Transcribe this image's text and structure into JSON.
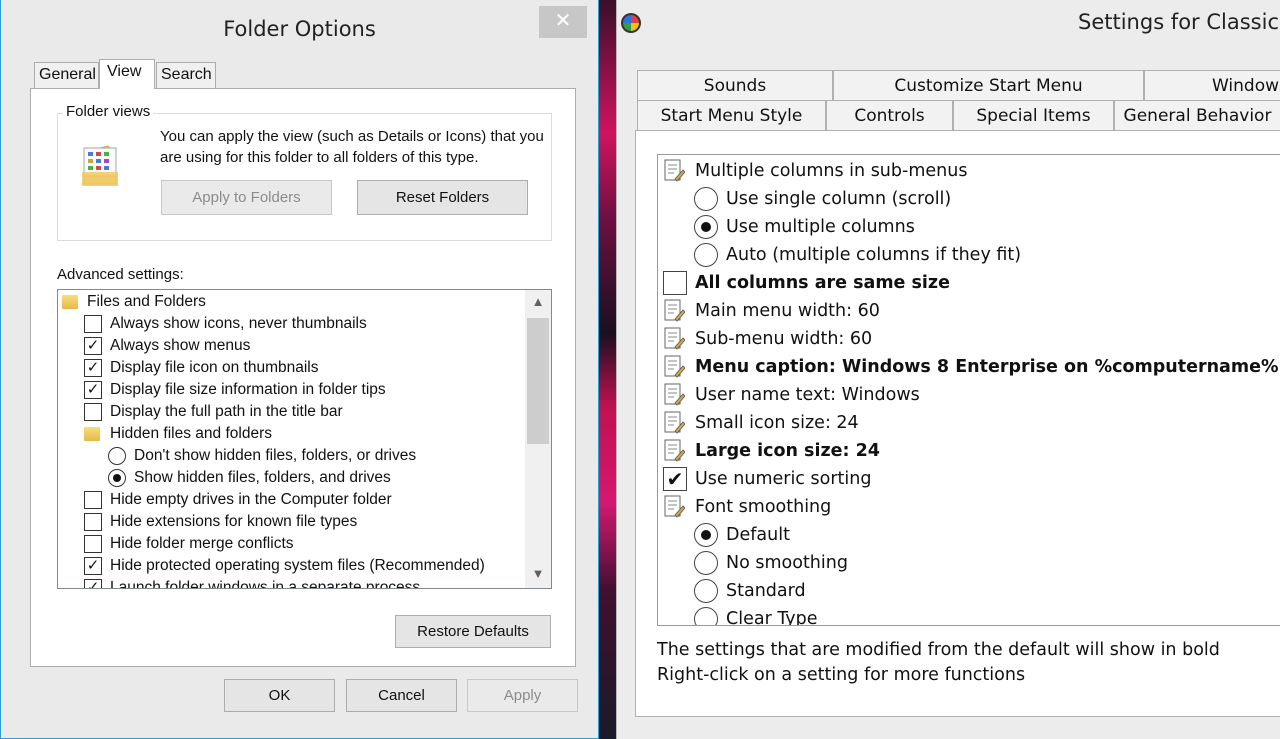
{
  "folder_options": {
    "title": "Folder Options",
    "close_glyph": "✕",
    "tabs": [
      "General",
      "View",
      "Search"
    ],
    "folder_views": {
      "label": "Folder views",
      "description": "You can apply the view (such as Details or Icons) that you are using for this folder to all folders of this type.",
      "apply_button": "Apply to Folders",
      "reset_button": "Reset Folders"
    },
    "advanced_label": "Advanced settings:",
    "tree": [
      {
        "type": "folder",
        "label": "Files and Folders"
      },
      {
        "type": "checkbox",
        "checked": false,
        "label": "Always show icons, never thumbnails"
      },
      {
        "type": "checkbox",
        "checked": true,
        "label": "Always show menus"
      },
      {
        "type": "checkbox",
        "checked": true,
        "label": "Display file icon on thumbnails"
      },
      {
        "type": "checkbox",
        "checked": true,
        "label": "Display file size information in folder tips"
      },
      {
        "type": "checkbox",
        "checked": false,
        "label": "Display the full path in the title bar"
      },
      {
        "type": "folder",
        "label": "Hidden files and folders"
      },
      {
        "type": "radio",
        "checked": false,
        "label": "Don't show hidden files, folders, or drives"
      },
      {
        "type": "radio",
        "checked": true,
        "label": "Show hidden files, folders, and drives"
      },
      {
        "type": "checkbox",
        "checked": false,
        "label": "Hide empty drives in the Computer folder"
      },
      {
        "type": "checkbox",
        "checked": false,
        "label": "Hide extensions for known file types"
      },
      {
        "type": "checkbox",
        "checked": false,
        "label": "Hide folder merge conflicts"
      },
      {
        "type": "checkbox",
        "checked": true,
        "label": "Hide protected operating system files (Recommended)"
      },
      {
        "type": "checkbox",
        "checked": true,
        "label": "Launch folder windows in a separate process"
      }
    ],
    "restore_button": "Restore Defaults",
    "ok_button": "OK",
    "cancel_button": "Cancel",
    "apply_button": "Apply"
  },
  "classic_shell": {
    "title": "Settings for Classic S",
    "tabs_row1": [
      "Sounds",
      "Customize Start Menu",
      "Windows"
    ],
    "tabs_row2": [
      "Start Menu Style",
      "Controls",
      "Special Items",
      "General Behavior"
    ],
    "settings": [
      {
        "type": "setting",
        "bold": false,
        "label": "Multiple columns in sub-menus"
      },
      {
        "type": "radio",
        "checked": false,
        "bold": false,
        "label": "Use single column (scroll)"
      },
      {
        "type": "radio",
        "checked": true,
        "bold": false,
        "label": "Use multiple columns"
      },
      {
        "type": "radio",
        "checked": false,
        "bold": false,
        "label": "Auto (multiple columns if they fit)"
      },
      {
        "type": "checkbox",
        "checked": false,
        "bold": true,
        "label": "All columns are same size"
      },
      {
        "type": "setting",
        "bold": false,
        "label": "Main menu width: 60"
      },
      {
        "type": "setting",
        "bold": false,
        "label": "Sub-menu width: 60"
      },
      {
        "type": "setting",
        "bold": true,
        "label": "Menu caption: Windows 8 Enterprise on %computername%"
      },
      {
        "type": "setting",
        "bold": false,
        "label": "User name text: Windows"
      },
      {
        "type": "setting",
        "bold": false,
        "label": "Small icon size: 24"
      },
      {
        "type": "setting",
        "bold": true,
        "label": "Large icon size: 24"
      },
      {
        "type": "checkbox",
        "checked": true,
        "bold": false,
        "label": "Use numeric sorting"
      },
      {
        "type": "setting",
        "bold": false,
        "label": "Font smoothing"
      },
      {
        "type": "radio",
        "checked": true,
        "bold": false,
        "label": "Default"
      },
      {
        "type": "radio",
        "checked": false,
        "bold": false,
        "label": "No smoothing"
      },
      {
        "type": "radio",
        "checked": false,
        "bold": false,
        "label": "Standard"
      },
      {
        "type": "radio",
        "checked": false,
        "bold": false,
        "label": "Clear Type"
      }
    ],
    "footer_line1": "The settings that are modified from the default will show in bold",
    "footer_line2": "Right-click on a setting for more functions"
  }
}
